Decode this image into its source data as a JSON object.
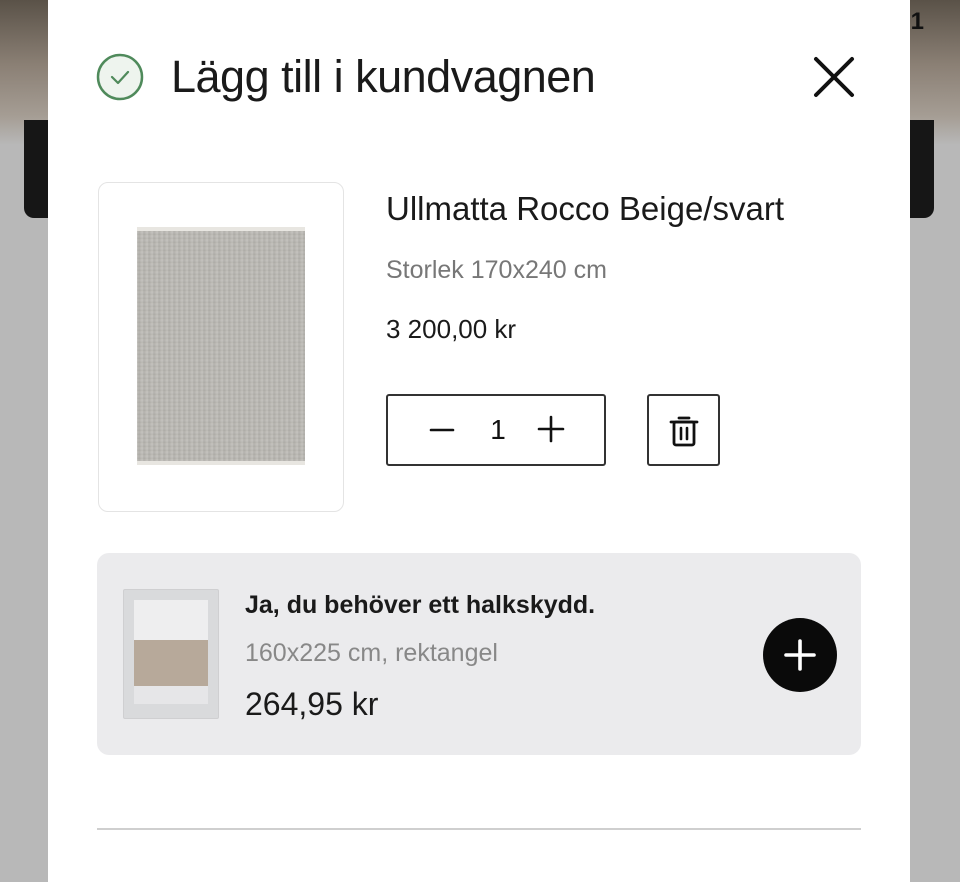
{
  "background": {
    "corner_text": "1"
  },
  "modal": {
    "title": "Lägg till i kundvagnen",
    "icons": {
      "status": "check-circle-icon",
      "close": "close-icon"
    },
    "colors": {
      "check_green": "#4f8a5b"
    }
  },
  "cart_item": {
    "name": "Ullmatta Rocco Beige/svart",
    "size": "Storlek 170x240 cm",
    "price": "3 200,00 kr",
    "quantity": "1",
    "icons": {
      "decrease": "minus-icon",
      "increase": "plus-icon",
      "remove": "trash-icon"
    }
  },
  "upsell": {
    "title": "Ja, du behöver ett halkskydd.",
    "description": "160x225 cm, rektangel",
    "price": "264,95 kr",
    "icons": {
      "add": "plus-icon"
    }
  }
}
